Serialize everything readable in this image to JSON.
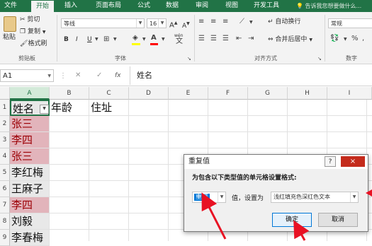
{
  "ribbon_tabs": [
    "文件",
    "开始",
    "插入",
    "页面布局",
    "公式",
    "数据",
    "审阅",
    "视图",
    "开发工具"
  ],
  "tell_me": "告诉我您想要做什么...",
  "clipboard": {
    "paste": "粘贴",
    "cut": "剪切",
    "copy": "复制",
    "format_painter": "格式刷",
    "group_label": "剪贴板"
  },
  "font": {
    "name": "等线",
    "size": "16",
    "bold": "B",
    "italic": "I",
    "underline": "U",
    "grow": "A",
    "shrink": "A",
    "wen": "wén",
    "group_label": "字体"
  },
  "alignment": {
    "wrap_text": "自动换行",
    "merge_center": "合并后居中",
    "group_label": "对齐方式"
  },
  "number": {
    "format": "常规",
    "group_label": "数字"
  },
  "formula_bar": {
    "name_box": "A1",
    "fx": "fx",
    "value": "姓名"
  },
  "columns": [
    "A",
    "B",
    "C",
    "D",
    "E",
    "F",
    "G",
    "H",
    "I"
  ],
  "rows": [
    "1",
    "2",
    "3",
    "4",
    "5",
    "6",
    "7",
    "8",
    "9"
  ],
  "sheet": {
    "header": [
      "姓名",
      "年龄",
      "住址"
    ],
    "names": [
      "张三",
      "李四",
      "张三",
      "李红梅",
      "王麻子",
      "李四",
      "刘毅",
      "李春梅"
    ]
  },
  "dialog": {
    "title": "重复值",
    "help": "?",
    "close": "×",
    "prompt": "为包含以下类型值的单元格设置格式:",
    "type_value": "重复",
    "middle_label": "值，设置为",
    "format_value": "浅红填充色深红色文本",
    "ok": "确定",
    "cancel": "取消"
  },
  "colors": {
    "excel_green": "#217346",
    "duplicate_fill": "#f4c7ce",
    "duplicate_text": "#9c0006",
    "annotation_arrow": "#e81123"
  }
}
